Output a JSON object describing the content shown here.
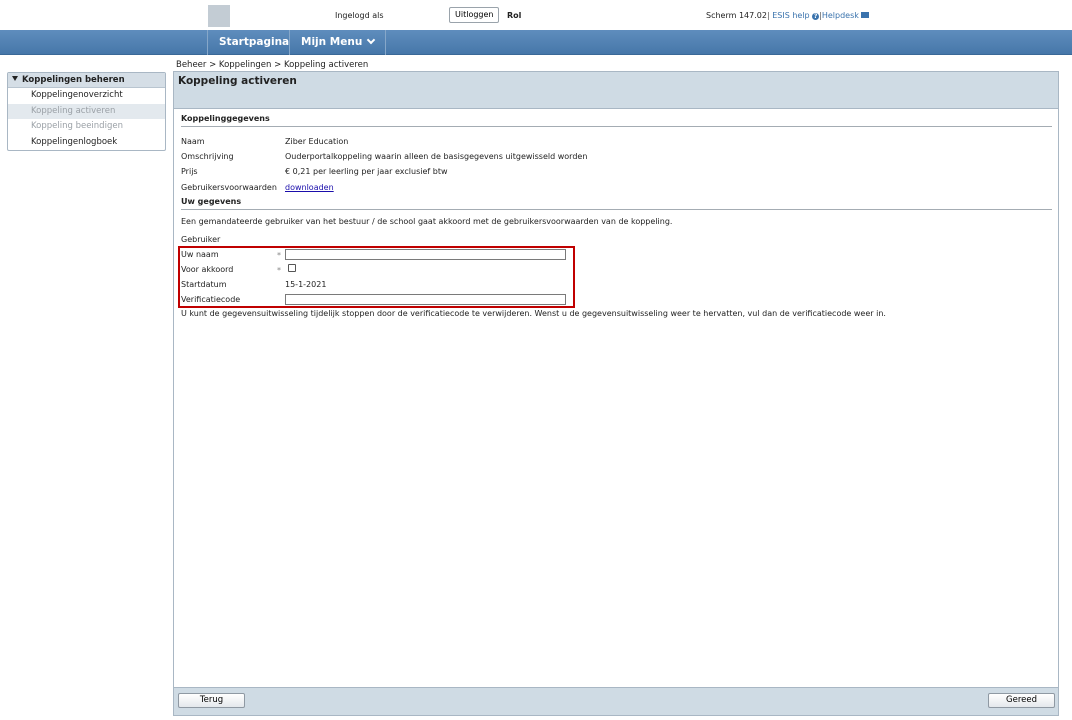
{
  "header": {
    "logged_in_label": "Ingelogd als",
    "logout_label": "Uitloggen",
    "role_label": "Rol",
    "screen_label": "Scherm 147.02",
    "help_label": "ESIS help",
    "helpdesk_label": "Helpdesk"
  },
  "nav": {
    "start": "Startpagina",
    "menu": "Mijn Menu"
  },
  "breadcrumb": "Beheer > Koppelingen > Koppeling activeren",
  "sidemenu": {
    "title": "Koppelingen beheren",
    "items": [
      {
        "label": "Koppelingenoverzicht"
      },
      {
        "label": "Koppeling activeren"
      },
      {
        "label": "Koppeling beeindigen"
      },
      {
        "label": "Koppelingenlogboek"
      }
    ]
  },
  "panel": {
    "title": "Koppeling activeren",
    "section1_title": "Koppelinggegevens",
    "name_label": "Naam",
    "name_value": "Ziber Education",
    "desc_label": "Omschrijving",
    "desc_value": "Ouderportalkoppeling waarin alleen de basisgegevens uitgewisseld worden",
    "price_label": "Prijs",
    "price_value": "€ 0,21 per leerling per jaar exclusief btw",
    "terms_label": "Gebruikersvoorwaarden",
    "terms_link": "downloaden",
    "section2_title": "Uw gegevens",
    "intro": "Een gemandateerde gebruiker van het bestuur / de school gaat akkoord met de gebruikersvoorwaarden van de koppeling.",
    "user_label": "Gebruiker",
    "your_name_label": "Uw naam",
    "your_name_value": "",
    "agree_label": "Voor akkoord",
    "required_mark": "*",
    "start_label": "Startdatum",
    "start_value": "15-1-2021",
    "code_label": "Verificatiecode",
    "code_value": "",
    "note": "U kunt de gegevensuitwisseling tijdelijk stoppen door de verificatiecode te verwijderen. Wenst u de gegevensuitwisseling weer te hervatten, vul dan de verificatiecode weer in.",
    "back_label": "Terug",
    "done_label": "Gereed"
  },
  "colors": {
    "nav_bar": "#4f80b2",
    "panel_header": "#cfdbe4",
    "highlight": "#c00000"
  }
}
